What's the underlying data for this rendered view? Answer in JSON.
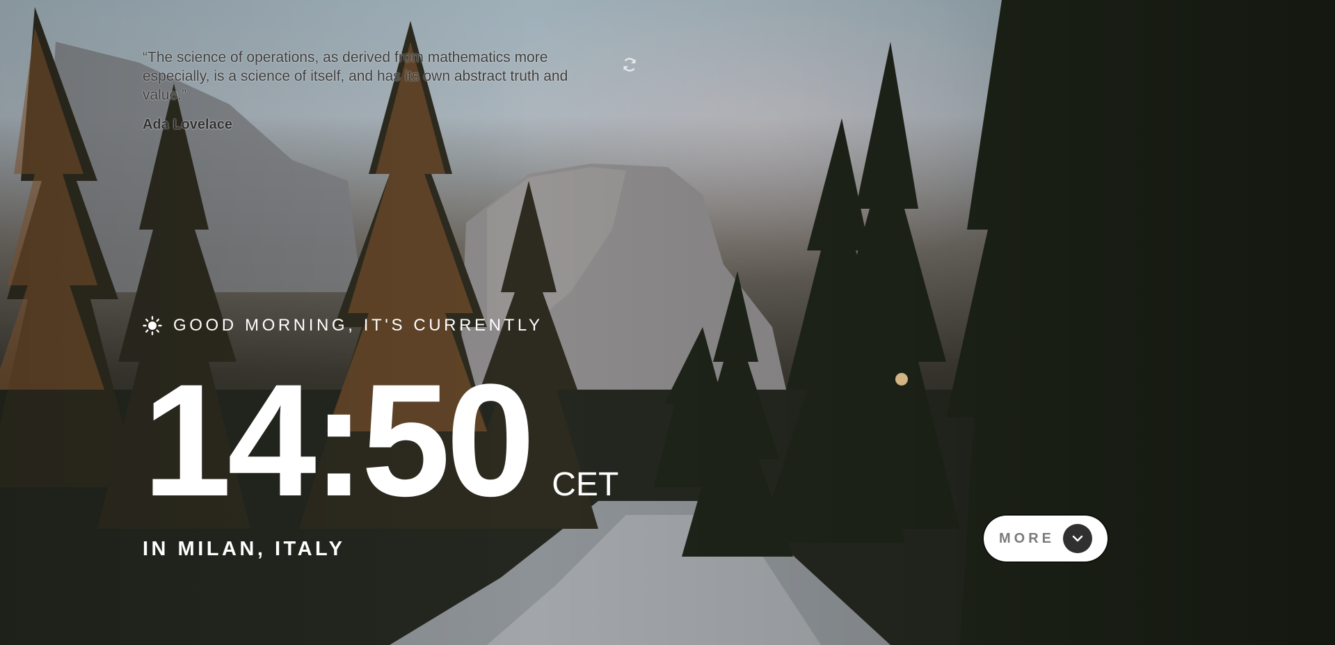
{
  "quote": {
    "text": "“The science of operations, as derived from mathematics more especially, is a science of itself, and has its own abstract truth and value.”",
    "author": "Ada Lovelace",
    "refresh_icon": "refresh-icon"
  },
  "greeting": {
    "icon": "sun-icon",
    "text": "GOOD MORNING, IT'S CURRENTLY"
  },
  "time": {
    "clock": "14:50",
    "timezone": "CET"
  },
  "location": {
    "text": "IN MILAN, ITALY"
  },
  "more_button": {
    "label": "MORE",
    "icon": "chevron-down-icon"
  },
  "colors": {
    "text_primary": "#ffffff",
    "button_bg": "#ffffff",
    "button_label": "#7a7a7a",
    "chevron_bg": "#303030"
  }
}
